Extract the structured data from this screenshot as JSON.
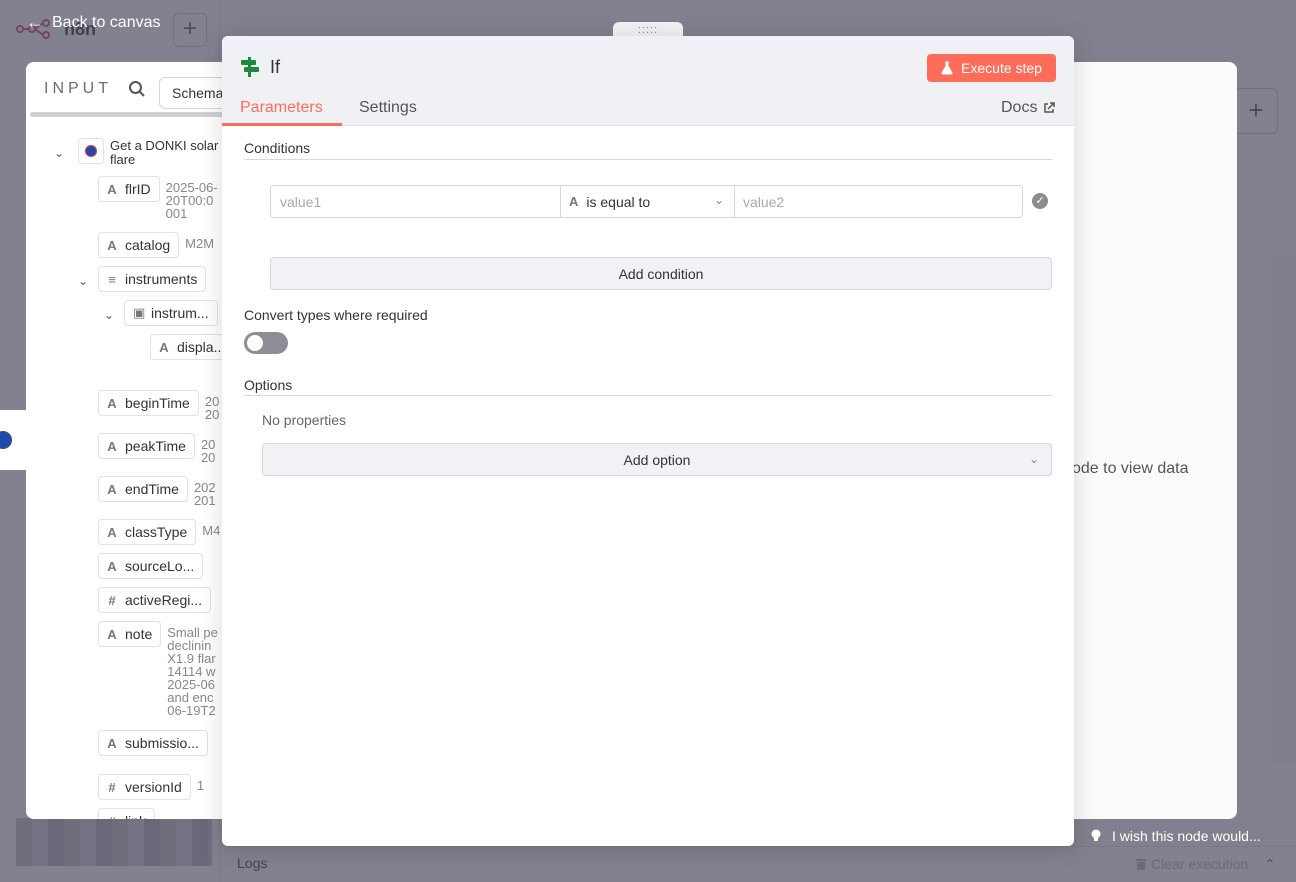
{
  "app": {
    "logo_text": "n8n",
    "back_label": "Back to canvas"
  },
  "input_panel": {
    "title": "INPUT",
    "view_tab": "Schema",
    "node_name": "Get a DONKI solar flare",
    "fields": [
      {
        "type": "A",
        "name": "flrID",
        "value": "2025-06-\n20T00:0\n001"
      },
      {
        "type": "A",
        "name": "catalog",
        "value": "M2M"
      },
      {
        "type": "list",
        "name": "instruments",
        "value": ""
      },
      {
        "type": "obj",
        "name": "instrum...",
        "value": ""
      },
      {
        "type": "A",
        "name": "displa...",
        "value": ""
      },
      {
        "type": "A",
        "name": "beginTime",
        "value": "20\n20"
      },
      {
        "type": "A",
        "name": "peakTime",
        "value": "20\n20"
      },
      {
        "type": "A",
        "name": "endTime",
        "value": "202\n201"
      },
      {
        "type": "A",
        "name": "classType",
        "value": "M4"
      },
      {
        "type": "A",
        "name": "sourceLo...",
        "value": ""
      },
      {
        "type": "#",
        "name": "activeRegi...",
        "value": ""
      },
      {
        "type": "A",
        "name": "note",
        "value": "Small pe\ndeclinin\nX1.9 flar\n14114 w\n2025-06\nand enc\n06-19T2"
      },
      {
        "type": "A",
        "name": "submissio...",
        "value": ""
      },
      {
        "type": "#",
        "name": "versionId",
        "value": "1"
      },
      {
        "type": "#",
        "name": "link",
        "value": ""
      }
    ]
  },
  "dialog": {
    "node_title": "If",
    "execute_label": "Execute step",
    "tabs": {
      "parameters": "Parameters",
      "settings": "Settings",
      "docs": "Docs"
    },
    "conditions_label": "Conditions",
    "condition": {
      "value1_placeholder": "value1",
      "operator": "is equal to",
      "value2_placeholder": "value2"
    },
    "add_condition_label": "Add condition",
    "convert_types_label": "Convert types where required",
    "convert_types_enabled": false,
    "options_label": "Options",
    "no_properties": "No properties",
    "add_option_label": "Add option"
  },
  "output_panel": {
    "hint": "ode to view data",
    "feedback": "I wish this node would..."
  },
  "footer": {
    "logs_label": "Logs",
    "clear_label": "Clear execution"
  },
  "colors": {
    "accent": "#ff6d5a",
    "if_icon": "#1b8a3c",
    "overlay": "#46465a"
  }
}
